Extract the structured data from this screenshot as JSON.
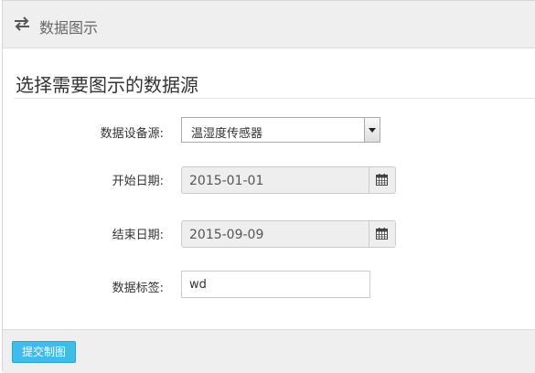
{
  "panel": {
    "title": "数据图示",
    "icon": "exchange-arrows-icon"
  },
  "section": {
    "title": "选择需要图示的数据源"
  },
  "form": {
    "device_source": {
      "label": "数据设备源:",
      "value": "温湿度传感器"
    },
    "start_date": {
      "label": "开始日期:",
      "value": "2015-01-01",
      "icon": "calendar-icon"
    },
    "end_date": {
      "label": "结束日期:",
      "value": "2015-09-09",
      "icon": "calendar-icon"
    },
    "data_tag": {
      "label": "数据标签:",
      "value": "wd"
    }
  },
  "footer": {
    "submit_label": "提交制图"
  },
  "colors": {
    "header_bg": "#efefef",
    "button_bg": "#3ebcf0",
    "readonly_bg": "#eeeeee"
  }
}
